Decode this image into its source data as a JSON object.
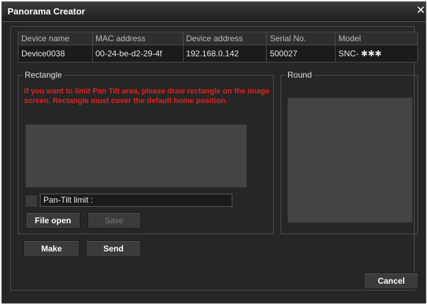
{
  "window": {
    "title": "Panorama Creator",
    "close_glyph": "✕"
  },
  "device_table": {
    "headers": [
      "Device name",
      "MAC address",
      "Device address",
      "Serial No.",
      "Model"
    ],
    "row": [
      "Device0038",
      "00-24-be-d2-29-4f",
      "192.168.0.142",
      "500027",
      "SNC- ✱✱✱"
    ]
  },
  "rectangle": {
    "legend": "Rectangle",
    "warning": "If you want to limit Pan Tilt area, please draw rectangle on the image screen. Rectangle must cover the default home position.",
    "pan_tilt_label": "Pan-Tilt limit :",
    "file_open_label": "File open",
    "save_label": "Save"
  },
  "round": {
    "legend": "Round"
  },
  "actions": {
    "make_label": "Make",
    "send_label": "Send",
    "cancel_label": "Cancel"
  },
  "colors": {
    "warning": "#e0231b",
    "background": "#262626",
    "preview": "#444444"
  }
}
